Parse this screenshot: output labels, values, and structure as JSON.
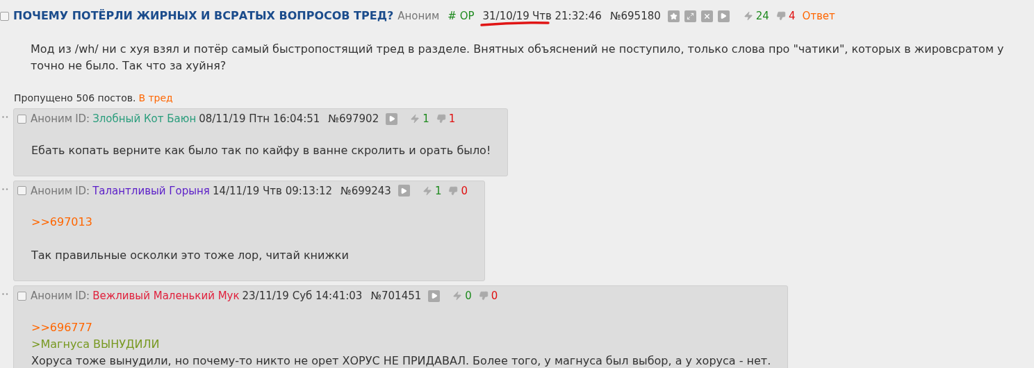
{
  "op": {
    "checked": false,
    "title": "ПОЧЕМУ ПОТЁРЛИ ЖИРНЫХ И ВСРАТЫХ ВОПРОСОВ ТРЕД?",
    "author": "Аноним",
    "trip": "# OP",
    "date": "31/10/19",
    "time": "Чтв 21:32:46",
    "number": "№695180",
    "likes": "24",
    "dislikes": "4",
    "reply": "Ответ",
    "body": [
      "Мод из /wh/ ни с хуя взял и потёр самый быстропостящий тред в разделе. Внятных объяснений не поступило, только слова про \"чатики\", которых в жировсратом у",
      "точно не было. Так что за хуйня?"
    ]
  },
  "omitted": {
    "text": "Пропущено 506 постов.",
    "link": "В тред"
  },
  "posts": [
    {
      "checked": false,
      "author": "Аноним",
      "id_label": "ID:",
      "id_name": "Злобный Кот Баюн",
      "color": "#2a9d7c",
      "date": "08/11/19 Птн 16:04:51",
      "number": "№697902",
      "likes": "1",
      "dislikes": "1",
      "paragraphs": [
        [
          {
            "kind": "text",
            "text": "Ебать копать верните как было так по кайфу в ванне скролить и орать было!"
          }
        ]
      ]
    },
    {
      "checked": false,
      "author": "Аноним",
      "id_label": "ID:",
      "id_name": "Талантливый Горыня",
      "color": "#5a1dc8",
      "date": "14/11/19 Чтв 09:13:12",
      "number": "№699243",
      "likes": "1",
      "dislikes": "0",
      "paragraphs": [
        [
          {
            "kind": "reply_link",
            "text": ">>697013"
          }
        ],
        [
          {
            "kind": "text",
            "text": "Так правильные осколки это тоже лор, читай книжки"
          }
        ]
      ]
    },
    {
      "checked": false,
      "author": "Аноним",
      "id_label": "ID:",
      "id_name": "Вежливый Маленький Мук",
      "color": "#e0203c",
      "date": "23/11/19 Суб 14:41:03",
      "number": "№701451",
      "likes": "0",
      "dislikes": "0",
      "paragraphs": [
        [
          {
            "kind": "reply_link",
            "text": ">>696777"
          },
          {
            "kind": "quote",
            "text": ">Магнуса ВЫНУДИЛИ"
          },
          {
            "kind": "text",
            "text": "Хоруса тоже вынудили, но почему-то никто не орет ХОРУС НЕ ПРИДАВАЛ. Более того, у магнуса был выбор, а у хоруса - нет."
          }
        ]
      ]
    }
  ]
}
